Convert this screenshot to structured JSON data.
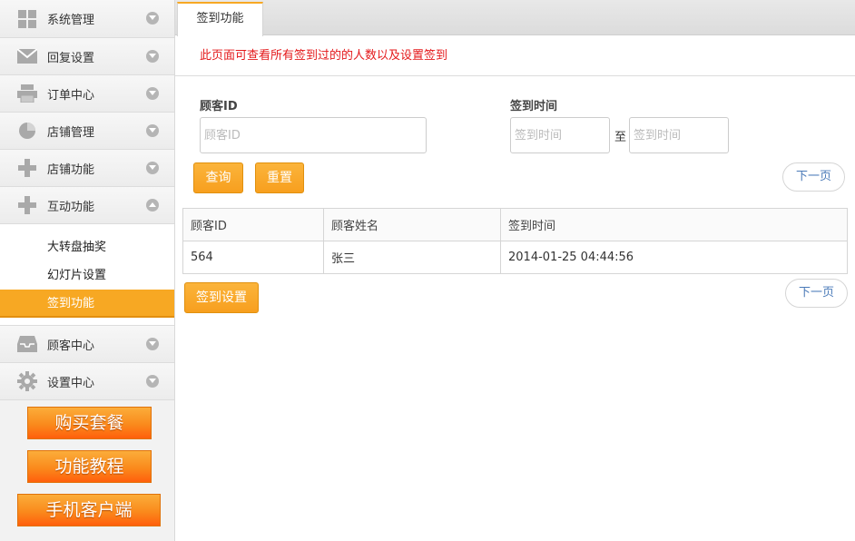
{
  "sidebar": {
    "items": [
      {
        "label": "系统管理",
        "icon": "grid-icon"
      },
      {
        "label": "回复设置",
        "icon": "envelope-icon"
      },
      {
        "label": "订单中心",
        "icon": "printer-icon"
      },
      {
        "label": "店铺管理",
        "icon": "pie-chart-icon"
      },
      {
        "label": "店铺功能",
        "icon": "plus-icon"
      },
      {
        "label": "互动功能",
        "icon": "plus-icon"
      }
    ],
    "submenu": [
      "大转盘抽奖",
      "幻灯片设置",
      "签到功能"
    ],
    "items_after": [
      {
        "label": "顾客中心",
        "icon": "inbox-icon"
      },
      {
        "label": "设置中心",
        "icon": "gear-icon"
      }
    ],
    "promo": [
      "购买套餐",
      "功能教程",
      "手机客户端"
    ]
  },
  "tab": {
    "label": "签到功能"
  },
  "notice": "此页面可查看所有签到过的的人数以及设置签到",
  "search": {
    "customer_id_label": "顾客ID",
    "customer_id_placeholder": "顾客ID",
    "sign_time_label": "签到时间",
    "sign_time_start_placeholder": "签到时间",
    "sign_time_end_placeholder": "签到时间",
    "to_text": "至",
    "query_button": "查询",
    "reset_button": "重置",
    "next_page": "下一页"
  },
  "table": {
    "columns": [
      "顾客ID",
      "顾客姓名",
      "签到时间"
    ],
    "rows": [
      [
        "564",
        "张三",
        "2014-01-25 04:44:56"
      ]
    ]
  },
  "footer": {
    "settings_button": "签到设置",
    "next_page": "下一页"
  },
  "colors": {
    "accent": "#f7a823",
    "notice": "#e4191b",
    "link": "#4a7ab8"
  }
}
